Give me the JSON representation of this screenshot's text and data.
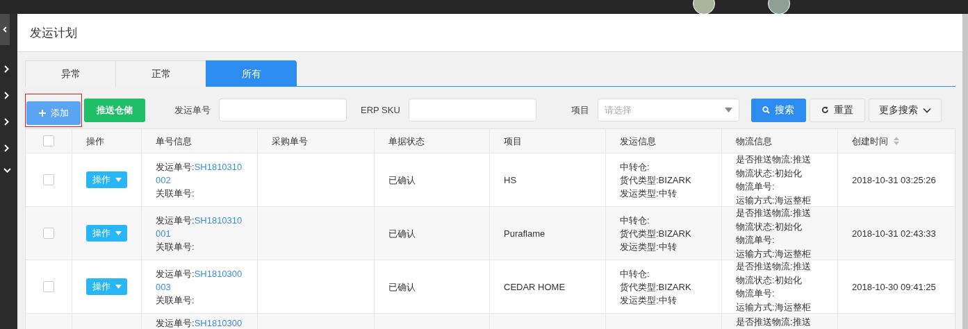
{
  "page_title": "发运计划",
  "tabs": [
    {
      "label": "异常",
      "selected": false
    },
    {
      "label": "正常",
      "selected": false
    },
    {
      "label": "所有",
      "selected": true
    }
  ],
  "toolbar": {
    "add_button": "添加",
    "push_button": "推送仓储",
    "filters": [
      {
        "kind": "text",
        "label": "发运单号"
      },
      {
        "kind": "text",
        "label": "ERP SKU"
      },
      {
        "kind": "select",
        "label": "项目",
        "placeholder": "请选择"
      }
    ],
    "search_button": "搜索",
    "reset_button": "重置",
    "more_button": "更多搜索"
  },
  "table": {
    "columns": [
      "操作",
      "单号信息",
      "采购单号",
      "单据状态",
      "项目",
      "发运信息",
      "物流信息",
      "创建时间"
    ],
    "select_all_checked": false,
    "rows": [
      {
        "checked": false,
        "action": "操作",
        "order_info": [
          "发运单号:",
          "SH1810310002",
          "关联单号:"
        ],
        "status": "已确认",
        "project": "HS",
        "shipping_info": [
          "中转仓:",
          "货代类型:BIZARK",
          "发运类型:中转"
        ],
        "logistics_info": [
          "是否推送物流:推送",
          "物流状态:初始化",
          "物流单号:",
          "运输方式:海运整柜"
        ],
        "created": "2018-10-31 03:25:26"
      },
      {
        "checked": false,
        "action": "操作",
        "order_info": [
          "发运单号:",
          "SH1810310001",
          "关联单号:"
        ],
        "status": "已确认",
        "project": "Puraflame",
        "shipping_info": [
          "中转仓:",
          "货代类型:BIZARK",
          "发运类型:中转"
        ],
        "logistics_info": [
          "是否推送物流:推送",
          "物流状态:初始化",
          "物流单号:",
          "运输方式:海运整柜"
        ],
        "created": "2018-10-31 02:43:33"
      },
      {
        "checked": false,
        "action": "操作",
        "order_info": [
          "发运单号:",
          "SH1810300003",
          "关联单号:"
        ],
        "status": "已确认",
        "project": "CEDAR HOME",
        "shipping_info": [
          "中转仓:",
          "货代类型:BIZARK",
          "发运类型:中转"
        ],
        "logistics_info": [
          "是否推送物流:推送",
          "物流状态:初始化",
          "物流单号:",
          "运输方式:海运整柜"
        ],
        "created": "2018-10-30 09:41:25"
      },
      {
        "kind": "partial",
        "order_info": [
          "发运单号:",
          "SH1810300"
        ],
        "logistics_info": [
          "是否推送物流:推送"
        ]
      }
    ]
  }
}
